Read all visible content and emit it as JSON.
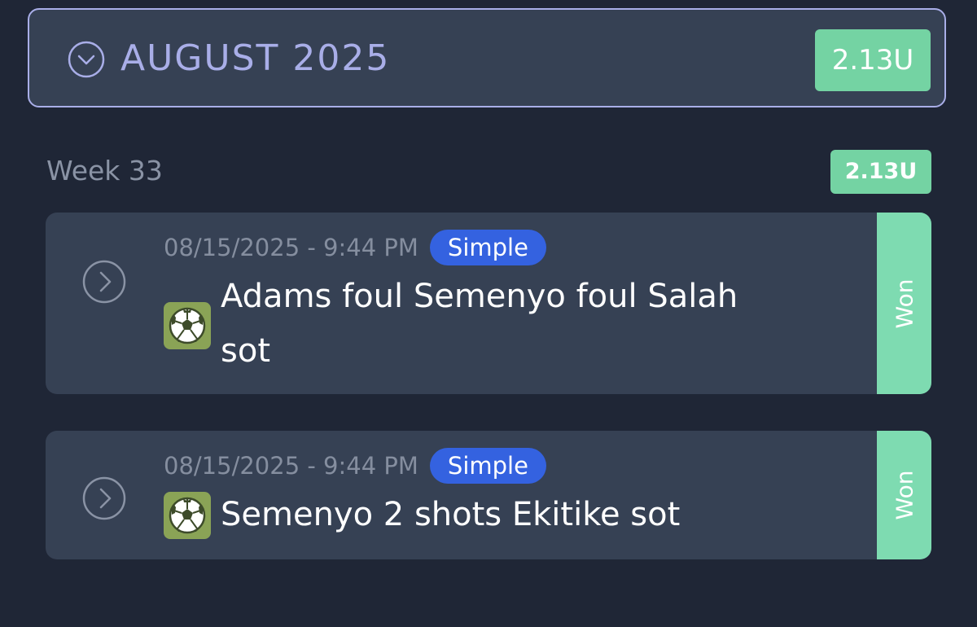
{
  "month": {
    "title": "AUGUST 2025",
    "total": "2.13U",
    "chevron_icon": "chevron-down-circle-icon"
  },
  "week": {
    "label": "Week 33",
    "total": "2.13U"
  },
  "bets": [
    {
      "datetime": "08/15/2025 - 9:44 PM",
      "type": "Simple",
      "title": "Adams foul Semenyo foul Salah sot",
      "status": "Won",
      "sport_icon": "soccer-ball-icon"
    },
    {
      "datetime": "08/15/2025 - 9:44 PM",
      "type": "Simple",
      "title": "Semenyo 2 shots Ekitike sot",
      "status": "Won",
      "sport_icon": "soccer-ball-icon"
    }
  ],
  "colors": {
    "background": "#1f2636",
    "card": "#364154",
    "accent": "#a9aee8",
    "won": "#7edbb1",
    "badge": "#3462e0"
  }
}
